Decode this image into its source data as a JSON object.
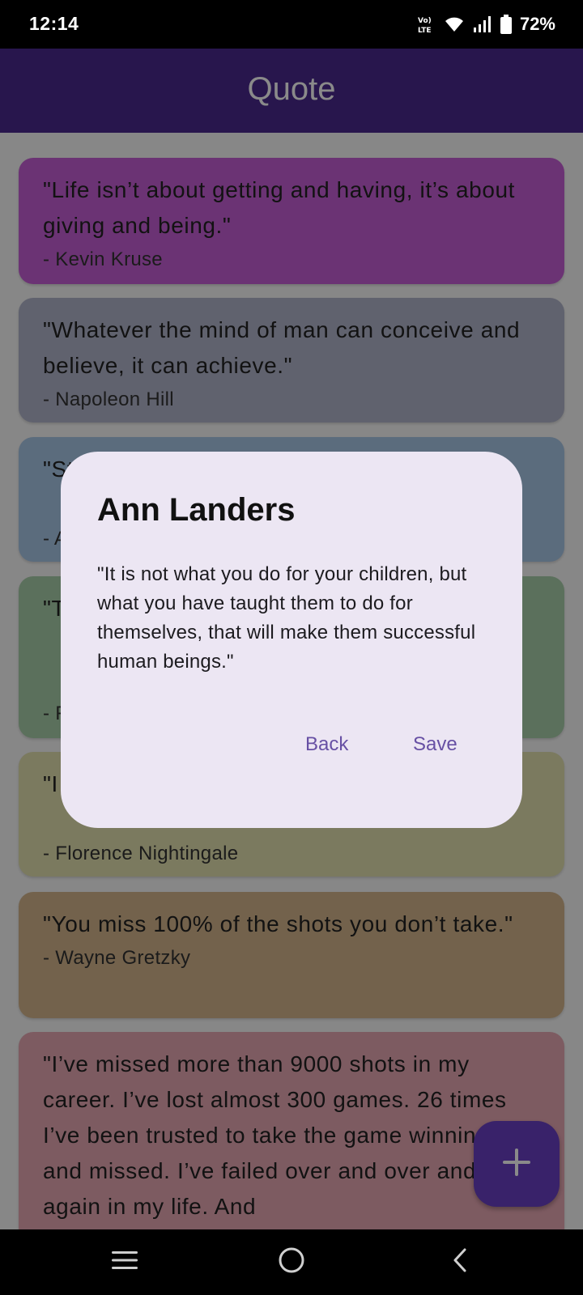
{
  "status_bar": {
    "time": "12:14",
    "battery": "72%",
    "icons": [
      "volte-icon",
      "wifi-icon",
      "signal-icon",
      "battery-icon"
    ]
  },
  "app_bar": {
    "title": "Quote"
  },
  "quotes": [
    {
      "text": "\"Life isn’t about getting and having, it’s about giving and being.\"",
      "author": "- Kevin Kruse",
      "color": "#c65fd6"
    },
    {
      "text": "\"Whatever the mind of man can conceive and believe, it can achieve.\"",
      "author": "- Napoleon Hill",
      "color": "#b1b5cc"
    },
    {
      "text": "\"St",
      "author": "- A",
      "color": "#a9c7e8"
    },
    {
      "text": "\"T",
      "author": "- F",
      "color": "#a9cfaa"
    },
    {
      "text": "\"I",
      "author": "- Florence Nightingale",
      "color": "#e3e1b0"
    },
    {
      "text": "\"You miss 100% of the shots you don’t take.\"",
      "author": "- Wayne Gretzky",
      "color": "#d5b68d"
    },
    {
      "text": "\"I’ve missed more than 9000 shots in my career. I’ve lost almost 300 games. 26 times I’ve been trusted to take the game winning shot and missed. I’ve failed over and over and over again in my life. And",
      "author": "",
      "color": "#e8a8b4"
    }
  ],
  "dialog": {
    "title": "Ann Landers",
    "body": "\"It is not what you do for your children, but what you have taught them to do for themselves, that will make them successful human beings.\"",
    "back_label": "Back",
    "save_label": "Save"
  },
  "fab": {
    "icon": "plus-icon"
  },
  "nav_bar": {
    "icons": [
      "menu-icon",
      "home-icon",
      "back-icon"
    ]
  },
  "colors": {
    "app_bar": "#4b2a8e",
    "fab": "#6a3fc4",
    "dialog_bg": "#ece6f3",
    "dialog_button": "#6750a4"
  }
}
